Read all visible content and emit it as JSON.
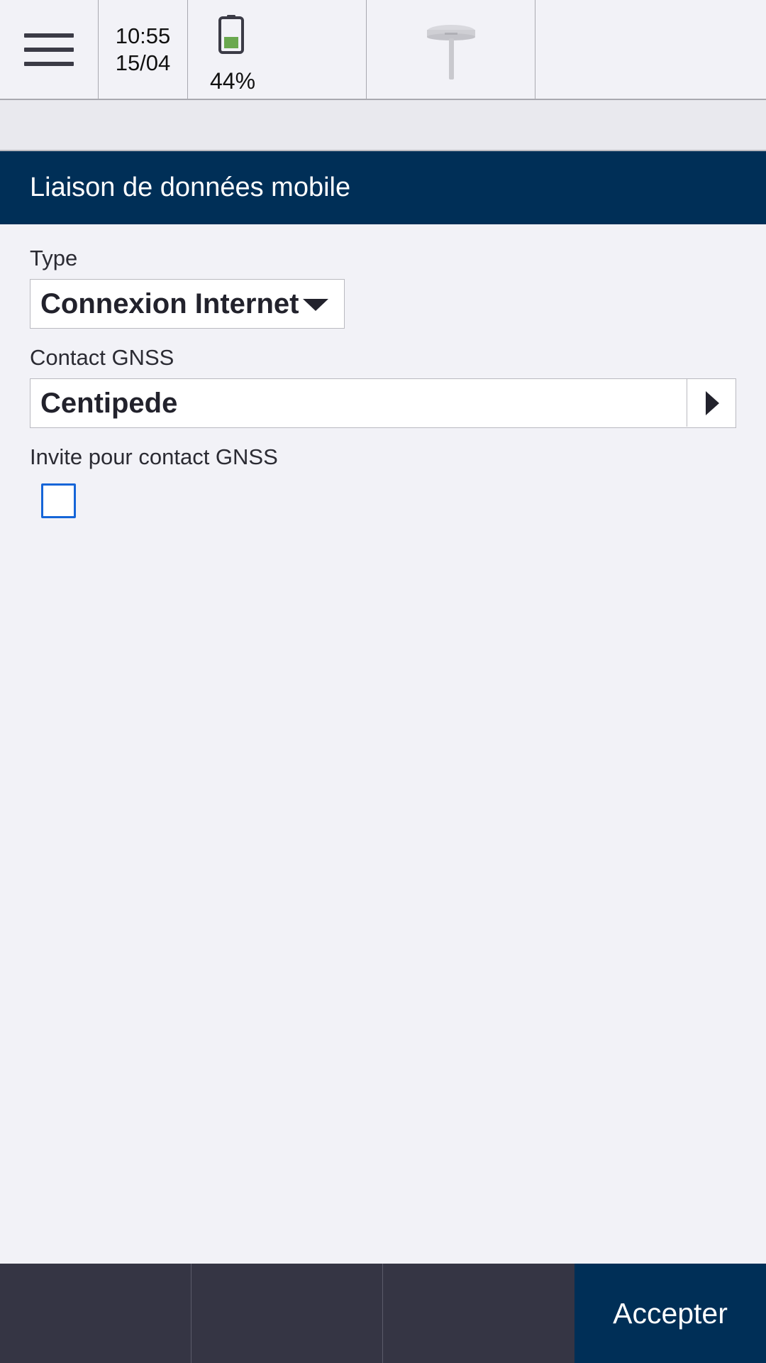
{
  "status_bar": {
    "time": "10:55",
    "date": "15/04",
    "battery_percent": "44%",
    "battery_level": 0.44,
    "battery_color": "#6aa84f",
    "menu_icon": "hamburger-menu-icon",
    "receiver_icon": "gnss-receiver-icon"
  },
  "header": {
    "title": "Liaison de données mobile"
  },
  "form": {
    "type_label": "Type",
    "type_value": "Connexion Internet",
    "gnss_contact_label": "Contact GNSS",
    "gnss_contact_value": "Centipede",
    "prompt_label": "Invite pour contact GNSS",
    "prompt_checked": false
  },
  "bottom_bar": {
    "accept_label": "Accepter"
  },
  "colors": {
    "title_bar": "#002f57",
    "bottom_bar": "#353544",
    "checkbox_border": "#1565d8"
  }
}
